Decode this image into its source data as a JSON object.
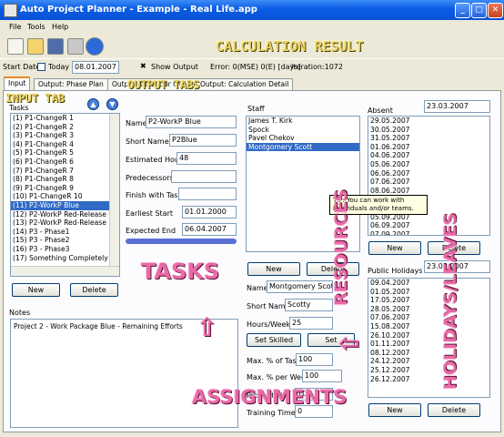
{
  "window": {
    "title": "Auto Project Planner - Example - Real Life.app",
    "minimize": "_",
    "maximize": "□",
    "close": "✕"
  },
  "menu": [
    "File",
    "Tools",
    "Help"
  ],
  "toolbar": {
    "icons": [
      "new-file-icon",
      "open-file-icon",
      "save-icon",
      "print-icon",
      "run-icon"
    ]
  },
  "status": {
    "start_date_label": "Start Date",
    "today_label": "Today",
    "start_date": "08.01.2007",
    "show_output_label": "Show Output",
    "error_text": "Error: 0(MSE) 0(E) [days]",
    "iteration_text": "Iteration:1072"
  },
  "tabs": [
    "Input",
    "Output: Phase Plan",
    "Output: Calendar Overview",
    "Output: Calculation Detail"
  ],
  "tasks": {
    "label": "Tasks",
    "items": [
      "(1) P1-ChangeR 1",
      "(2) P1-ChangeR 2",
      "(3) P1-ChangeR 3",
      "(4) P1-ChangeR 4",
      "(5) P1-ChangeR 5",
      "(6) P1-ChangeR 6",
      "(7) P1-ChangeR 7",
      "(8) P1-ChangeR 8",
      "(9) P1-ChangeR 9",
      "(10) P1-ChangeR 10",
      "(11) P2-WorkP Blue",
      "(12) P2-WorkP Red-Release Can",
      "(13) P2-WorkP Red-Release",
      "(14) P3 - Phase1",
      "(15) P3 - Phase2",
      "(16) P3 - Phase3",
      "(17) Something Completely Diffe"
    ],
    "selected_index": 10,
    "new_label": "New",
    "delete_label": "Delete"
  },
  "task_form": {
    "name_label": "Name",
    "name_value": "P2-WorkP Blue",
    "short_name_label": "Short Name",
    "short_name_value": "P2Blue",
    "estimated_hours_label": "Estimated Hours",
    "estimated_hours_value": "48",
    "predecessors_label": "Predecessors",
    "predecessors_value": "",
    "finish_with_task_label": "Finish with Task",
    "finish_with_task_value": "",
    "earliest_start_label": "Earliest Start",
    "earliest_start_value": "01.01.2000",
    "expected_end_label": "Expected End",
    "expected_end_value": "06.04.2007",
    "bar_color": "#5a6fd6"
  },
  "notes": {
    "label": "Notes",
    "text": "Project 2 - Work Package Blue - Remaining Efforts"
  },
  "staff": {
    "label": "Staff",
    "items": [
      "James T. Kirk",
      "Spock",
      "Pavel Chekov",
      "Montgomery Scott"
    ],
    "selected_index": 3,
    "new_label": "New",
    "delete_label": "Delete"
  },
  "staff_form": {
    "name_label": "Name",
    "name_value": "Montgomery Scott",
    "short_name_label": "Short Name",
    "short_name_value": "Scotty",
    "hours_week_label": "Hours/Week",
    "hours_week_value": "25",
    "set_skilled_label": "Set Skilled",
    "set_unskilled_label": "Set Unskilled",
    "max_task_label": "Max. % of Task",
    "max_task_value": "100",
    "max_week_label": "Max. % per Week",
    "max_week_value": "100",
    "productivity_label": "Productivity [%]",
    "productivity_value": "100",
    "training_label": "Training Time [h]",
    "training_value": "0"
  },
  "absent": {
    "label": "Absent",
    "date": "23.03.2007",
    "items": [
      "29.05.2007",
      "30.05.2007",
      "31.05.2007",
      "01.06.2007",
      "04.06.2007",
      "05.06.2007",
      "06.06.2007",
      "07.06.2007",
      "08.06.2007",
      "03.09.2007",
      "04.09.2007",
      "05.09.2007",
      "06.09.2007",
      "07.09.2007",
      "10.09.2007"
    ],
    "new_label": "New",
    "delete_label": "Delete"
  },
  "holidays": {
    "label": "Public Holidays",
    "date": "23.03.2007",
    "items": [
      "09.04.2007",
      "01.05.2007",
      "17.05.2007",
      "28.05.2007",
      "07.06.2007",
      "15.08.2007",
      "26.10.2007",
      "01.11.2007",
      "08.12.2007",
      "24.12.2007",
      "25.12.2007",
      "26.12.2007"
    ],
    "new_label": "New",
    "delete_label": "Delete"
  },
  "tooltip": {
    "line1": "TIP: You can work with",
    "line2": "individuals and/or teams."
  },
  "annotations": {
    "calculation_result": "CALCULATION RESULT",
    "input_tab": "INPUT TAB",
    "output_tabs": "OUTPUT TABS",
    "tasks": "TASKS",
    "assignments": "ASSIGNMENTS",
    "resources": "RESOURCES",
    "holidays_leaves": "HOLIDAYS/LEAVES",
    "overlay_color": "#e8d16a",
    "overlay_pink": "#e86aa8"
  }
}
